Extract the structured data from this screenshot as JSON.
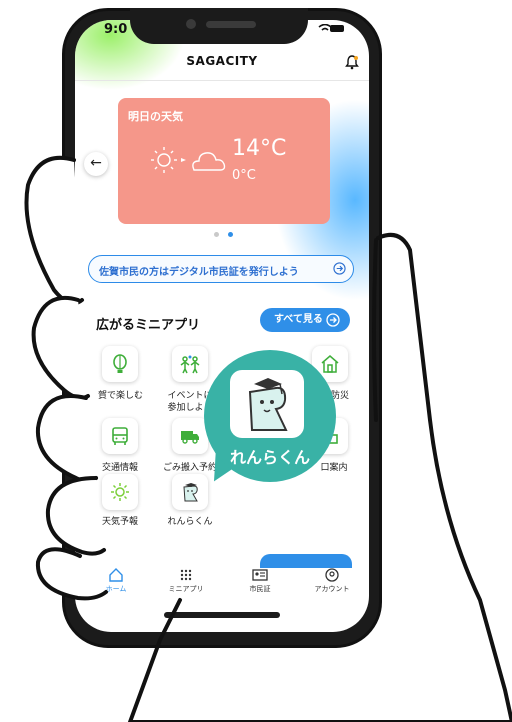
{
  "status_bar": {
    "time": "9:0"
  },
  "header": {
    "title": "SAGACITY",
    "bell_icon": "bell-icon"
  },
  "weather": {
    "title": "明日の天気",
    "temp_high": "14°C",
    "temp_low": "0°C",
    "color": "#f5978a"
  },
  "carousel": {
    "active_index": 2,
    "count": 2
  },
  "banner": {
    "text": "佐賀市民の方はデジタル市民証を発行しよう"
  },
  "mini_apps": {
    "title": "広がるミニアプリ",
    "see_all": "すべて見る",
    "items": [
      {
        "label": "賀で楽しむ",
        "icon": "balloon-icon"
      },
      {
        "label": "イベントに",
        "label2": "参加しよう",
        "icon": "event-people-icon"
      },
      {
        "label": "防災",
        "icon": "house-disaster-icon"
      },
      {
        "label": "交通情報",
        "icon": "bus-icon"
      },
      {
        "label": "ごみ搬入予約",
        "icon": "truck-icon"
      },
      {
        "label": "口案内",
        "icon": "desk-icon"
      },
      {
        "label": "天気予報",
        "icon": "sun-icon"
      },
      {
        "label": "れんらくん",
        "icon": "renrakun-mascot-icon"
      }
    ],
    "feature": {
      "label": "れんらくん",
      "color": "#39b2a6"
    }
  },
  "tabbar": {
    "tabs": [
      {
        "label": "ホーム",
        "icon": "home-icon",
        "active": true
      },
      {
        "label": "ミニアプリ",
        "icon": "grid-icon",
        "active": false
      },
      {
        "label": "市民証",
        "icon": "id-card-icon",
        "active": false
      },
      {
        "label": "アカウント",
        "icon": "account-icon",
        "active": false
      }
    ]
  },
  "colors": {
    "accent": "#2f8fe8",
    "feature": "#39b2a6"
  }
}
